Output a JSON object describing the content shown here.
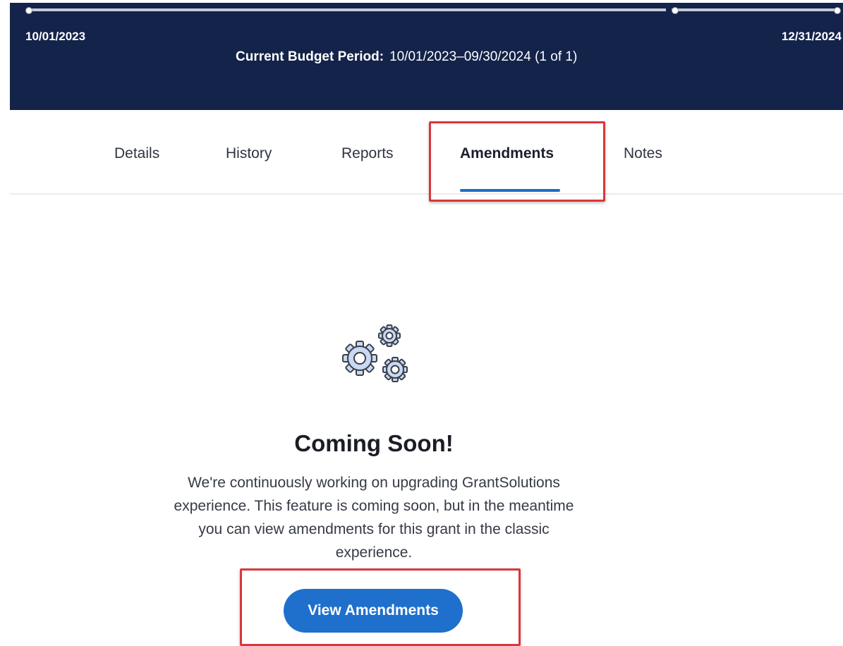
{
  "header": {
    "start_date": "10/01/2023",
    "end_date": "12/31/2024",
    "budget_period_label": "Current Budget Period:",
    "budget_period_value": "10/01/2023–09/30/2024 (1 of 1)"
  },
  "tabs": [
    {
      "label": "Details",
      "active": false
    },
    {
      "label": "History",
      "active": false
    },
    {
      "label": "Reports",
      "active": false
    },
    {
      "label": "Amendments",
      "active": true
    },
    {
      "label": "Notes",
      "active": false
    }
  ],
  "content": {
    "icon": "gears-icon",
    "title": "Coming Soon!",
    "message": "We're continuously working on upgrading GrantSolutions experience. This feature is coming soon, but in the meantime you can view amendments for this grant in the classic experience.",
    "button_label": "View Amendments"
  },
  "colors": {
    "header_bg": "#14234a",
    "accent": "#1e70cc",
    "highlight": "#d9373a"
  }
}
